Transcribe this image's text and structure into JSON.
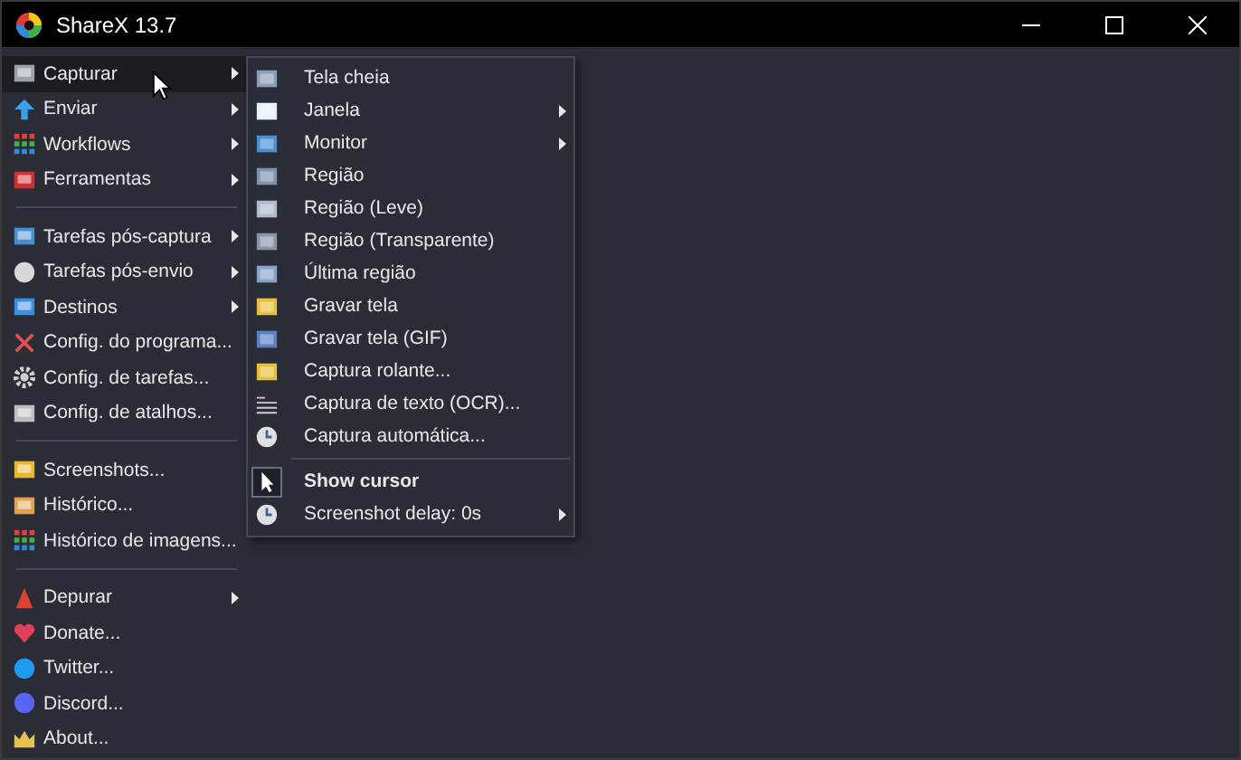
{
  "window": {
    "title": "ShareX 13.7"
  },
  "menu": {
    "groups": [
      [
        {
          "label": "Capturar",
          "submenu": true,
          "selected": true
        },
        {
          "label": "Enviar",
          "submenu": true,
          "selected": false
        },
        {
          "label": "Workflows",
          "submenu": true,
          "selected": false
        },
        {
          "label": "Ferramentas",
          "submenu": true,
          "selected": false
        }
      ],
      [
        {
          "label": "Tarefas pós-captura",
          "submenu": true,
          "selected": false
        },
        {
          "label": "Tarefas pós-envio",
          "submenu": true,
          "selected": false
        },
        {
          "label": "Destinos",
          "submenu": true,
          "selected": false
        },
        {
          "label": "Config. do programa...",
          "submenu": false,
          "selected": false
        },
        {
          "label": "Config. de tarefas...",
          "submenu": false,
          "selected": false
        },
        {
          "label": "Config. de atalhos...",
          "submenu": false,
          "selected": false
        }
      ],
      [
        {
          "label": "Screenshots...",
          "submenu": false,
          "selected": false
        },
        {
          "label": "Histórico...",
          "submenu": false,
          "selected": false
        },
        {
          "label": "Histórico de imagens...",
          "submenu": false,
          "selected": false
        }
      ],
      [
        {
          "label": "Depurar",
          "submenu": true,
          "selected": false
        },
        {
          "label": "Donate...",
          "submenu": false,
          "selected": false
        },
        {
          "label": "Twitter...",
          "submenu": false,
          "selected": false
        },
        {
          "label": "Discord...",
          "submenu": false,
          "selected": false
        },
        {
          "label": "About...",
          "submenu": false,
          "selected": false
        }
      ]
    ]
  },
  "submenu": {
    "groups": [
      [
        {
          "label": "Tela cheia",
          "kind": "action",
          "submenu": false
        },
        {
          "label": "Janela",
          "kind": "action",
          "submenu": true
        },
        {
          "label": "Monitor",
          "kind": "action",
          "submenu": true
        },
        {
          "label": "Região",
          "kind": "action",
          "submenu": false
        },
        {
          "label": "Região (Leve)",
          "kind": "action",
          "submenu": false
        },
        {
          "label": "Região (Transparente)",
          "kind": "action",
          "submenu": false
        },
        {
          "label": "Última região",
          "kind": "action",
          "submenu": false
        },
        {
          "label": "Gravar tela",
          "kind": "action",
          "submenu": false
        },
        {
          "label": "Gravar tela (GIF)",
          "kind": "action",
          "submenu": false
        },
        {
          "label": "Captura rolante...",
          "kind": "action",
          "submenu": false
        },
        {
          "label": "Captura de texto (OCR)...",
          "kind": "action",
          "submenu": false
        },
        {
          "label": "Captura automática...",
          "kind": "action",
          "submenu": false
        }
      ],
      [
        {
          "label": "Show cursor",
          "kind": "toggle",
          "checked": true,
          "submenu": false
        },
        {
          "label": "Screenshot delay: 0s",
          "kind": "action",
          "submenu": true
        }
      ]
    ]
  }
}
